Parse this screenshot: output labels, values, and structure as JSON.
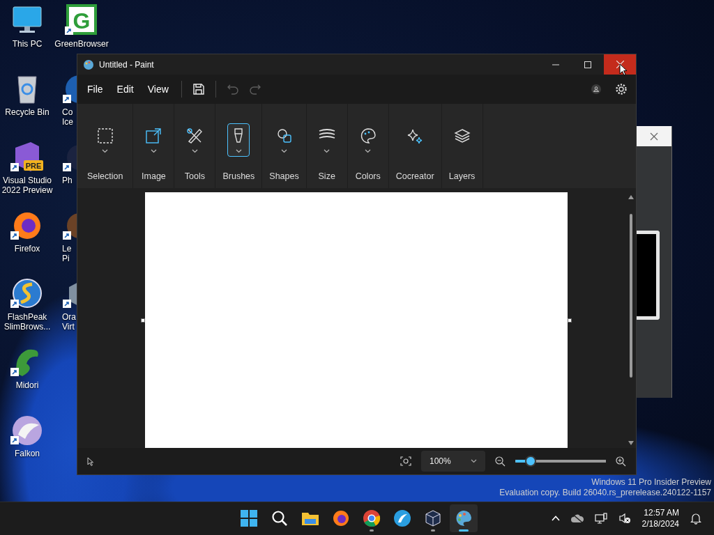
{
  "desktop_icon_columns": [
    [
      {
        "kind": "monitor",
        "label_lines": [
          "This PC"
        ],
        "shortcut": false
      },
      {
        "kind": "bin",
        "label_lines": [
          "Recycle Bin"
        ],
        "shortcut": false
      },
      {
        "kind": "studio",
        "label_lines": [
          "Visual Studio",
          "2022 Preview"
        ],
        "badge": "PRE",
        "shortcut": true
      },
      {
        "kind": "foxglobe",
        "label_lines": [
          "Firefox"
        ],
        "shortcut": true
      },
      {
        "kind": "sglobe",
        "label_lines": [
          "FlashPeak",
          "SlimBrows..."
        ],
        "shortcut": true
      },
      {
        "kind": "lizard",
        "label_lines": [
          "Midori"
        ],
        "shortcut": true
      },
      {
        "kind": "bird",
        "label_lines": [
          "Falkon"
        ],
        "shortcut": true
      }
    ],
    [
      {
        "kind": "letter",
        "label_lines": [
          "GreenBrowser"
        ],
        "badge": "G",
        "shortcut": true
      },
      {
        "kind": "bluedisc",
        "label_lines": [
          "Co",
          "Ice"
        ],
        "shortcut": true
      },
      {
        "kind": "night",
        "label_lines": [
          "Ph"
        ],
        "shortcut": true
      },
      {
        "kind": "brown",
        "label_lines": [
          "Le",
          "Pi"
        ],
        "shortcut": true
      },
      {
        "kind": "box",
        "label_lines": [
          "Ora",
          "Virt"
        ],
        "shortcut": true
      }
    ]
  ],
  "window": {
    "title": "Untitled - Paint",
    "close_hovered": true,
    "menu": [
      "File",
      "Edit",
      "View"
    ],
    "quick_actions": [
      {
        "kind": "save",
        "disabled": false
      },
      {
        "kind": "undo",
        "disabled": true
      },
      {
        "kind": "redo",
        "disabled": true
      }
    ],
    "ribbon": [
      {
        "kind": "selection",
        "label": "Selection",
        "dropdown": true,
        "selected": false
      },
      {
        "kind": "image",
        "label": "Image",
        "dropdown": true,
        "selected": false
      },
      {
        "kind": "tools",
        "label": "Tools",
        "dropdown": true,
        "selected": false
      },
      {
        "kind": "brushes",
        "label": "Brushes",
        "dropdown": true,
        "selected": true
      },
      {
        "kind": "shapes",
        "label": "Shapes",
        "dropdown": true,
        "selected": false
      },
      {
        "kind": "size",
        "label": "Size",
        "dropdown": true,
        "selected": false
      },
      {
        "kind": "colors",
        "label": "Colors",
        "dropdown": true,
        "selected": false
      },
      {
        "kind": "cocreator",
        "label": "Cocreator",
        "dropdown": false,
        "selected": false
      },
      {
        "kind": "layers",
        "label": "Layers",
        "dropdown": false,
        "selected": false
      }
    ],
    "status_bar": {
      "zoom": "100%",
      "zoom_slider": {
        "level": 0.17
      }
    }
  },
  "watermark_lines": [
    "Windows 11 Pro Insider Preview",
    "Evaluation copy. Build 26040.rs_prerelease.240122-1157"
  ],
  "taskbar": {
    "apps": [
      {
        "kind": "start",
        "running": false,
        "selected": false
      },
      {
        "kind": "search",
        "running": false,
        "selected": false
      },
      {
        "kind": "folder",
        "running": false,
        "selected": false
      },
      {
        "kind": "foxglobe",
        "running": false,
        "selected": false
      },
      {
        "kind": "chrome",
        "running": true,
        "selected": false
      },
      {
        "kind": "birddisc",
        "running": false,
        "selected": false
      },
      {
        "kind": "box",
        "running": true,
        "selected": false
      },
      {
        "kind": "palette",
        "running": true,
        "selected": true
      }
    ],
    "time": "12:57 AM",
    "date": "2/18/2024"
  }
}
